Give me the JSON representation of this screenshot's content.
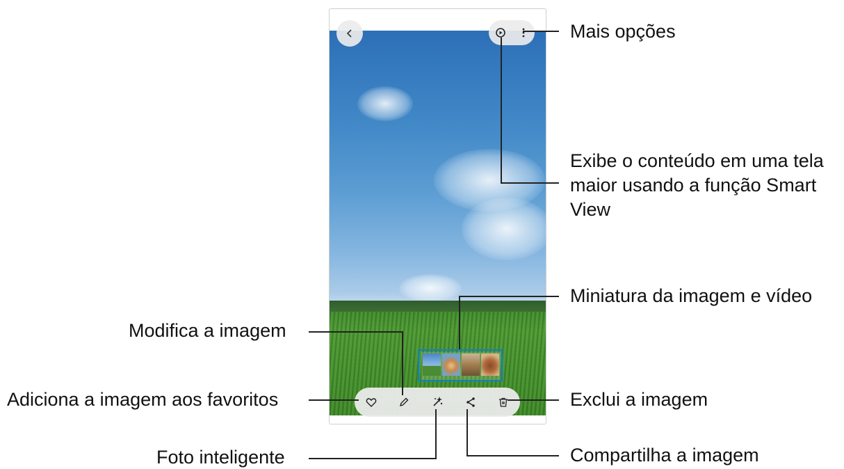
{
  "callouts": {
    "more_options": "Mais opções",
    "smart_view_line1": "Exibe o conteúdo em uma tela",
    "smart_view_line2": "maior usando a função Smart",
    "smart_view_line3": "View",
    "thumbnail": "Miniatura da imagem e vídeo",
    "edit": "Modifica a imagem",
    "favorite": "Adiciona a imagem aos favoritos",
    "delete": "Exclui a imagem",
    "smart_photo": "Foto inteligente",
    "share": "Compartilha a imagem"
  },
  "icons": {
    "back": "chevron-left-icon",
    "smart_view": "smart-view-icon",
    "more": "more-vertical-icon",
    "heart": "heart-icon",
    "edit": "pencil-icon",
    "ai": "sparkle-icon",
    "share": "share-icon",
    "delete": "trash-icon"
  },
  "colors": {
    "accent_box": "#0f7fd0",
    "leader_line": "#222222"
  }
}
